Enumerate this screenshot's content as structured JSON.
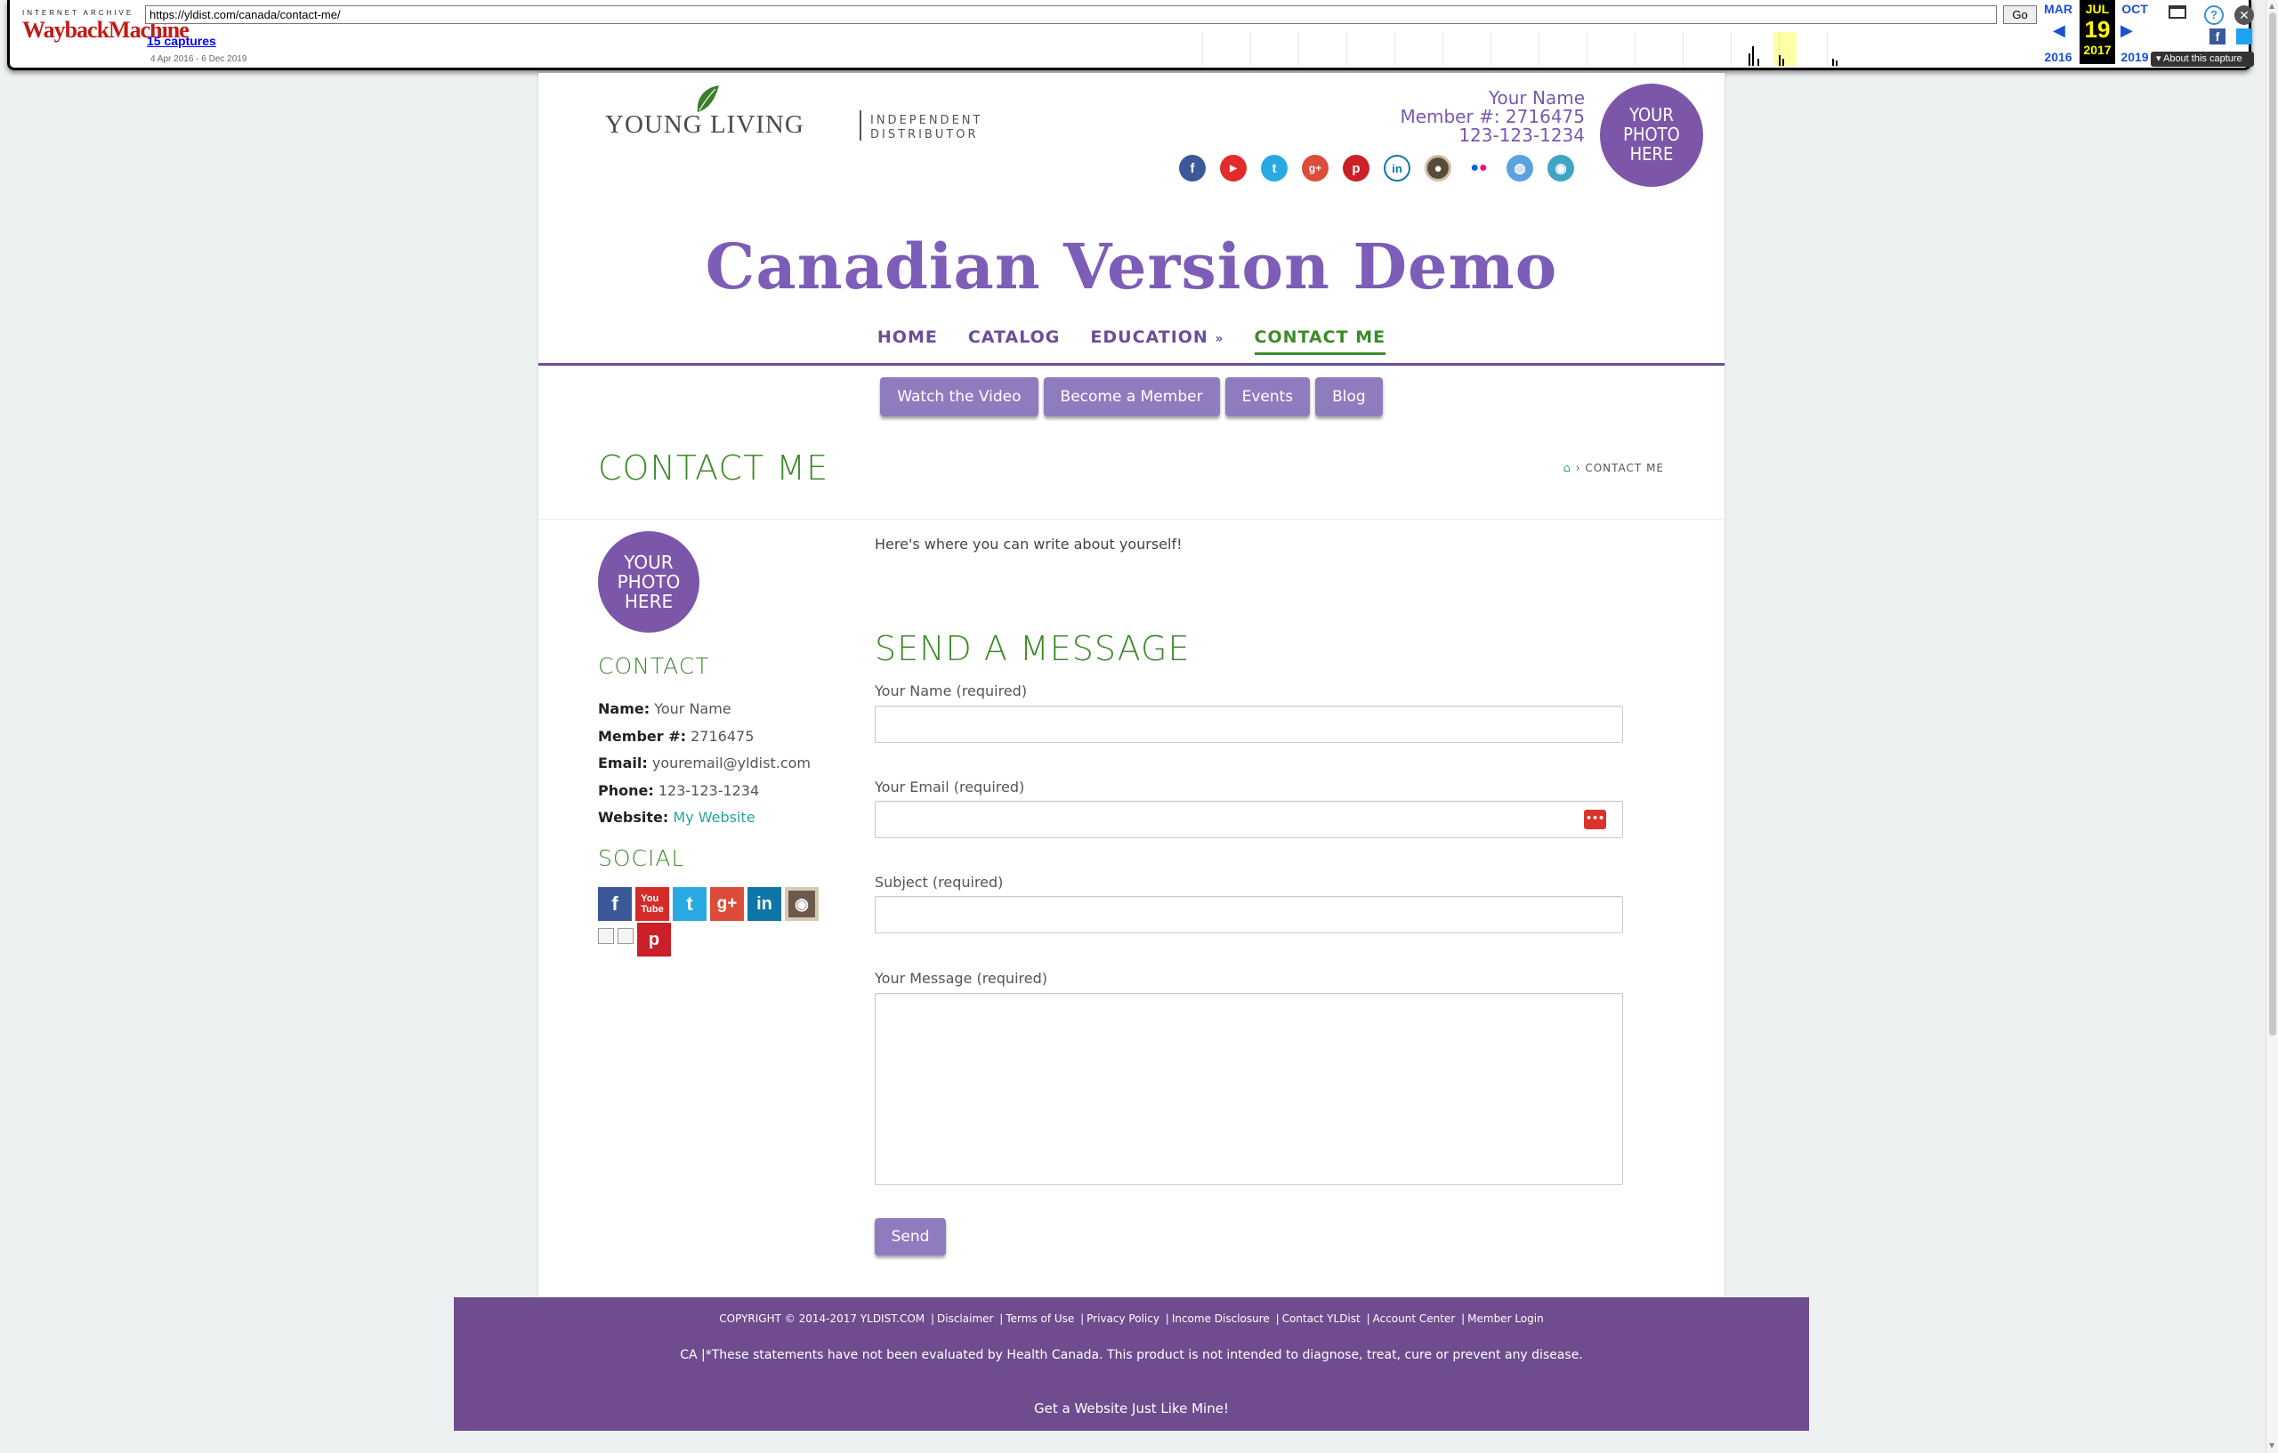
{
  "wayback": {
    "logo_top": "INTERNET ARCHIVE",
    "logo_way": "WaybackMachine",
    "url": "https://yldist.com/canada/contact-me/",
    "go_label": "Go",
    "captures": "15 captures",
    "range": "4 Apr 2016 - 6 Dec 2019",
    "prev_month": "MAR",
    "cur_month": "JUL",
    "next_month": "OCT",
    "cur_day": "19",
    "prev_year": "2016",
    "cur_year": "2017",
    "next_year": "2019",
    "about": "About this capture"
  },
  "header": {
    "logo_brand": "YOUNG LIVING",
    "logo_sub_1": "INDEPENDENT",
    "logo_sub_2": "DISTRIBUTOR",
    "name": "Your Name",
    "member": "Member #: 2716475",
    "phone": "123-123-1234",
    "photo_text_1": "YOUR",
    "photo_text_2": "PHOTO",
    "photo_text_3": "HERE",
    "social_icons": [
      "facebook-icon",
      "youtube-icon",
      "twitter-icon",
      "googleplus-icon",
      "pinterest-icon",
      "linkedin-icon",
      "instagram-icon",
      "flickr-icon",
      "website-icon",
      "periscope-icon"
    ]
  },
  "site_title": "Canadian Version Demo",
  "nav": {
    "items": [
      {
        "label": "HOME"
      },
      {
        "label": "CATALOG"
      },
      {
        "label": "EDUCATION"
      },
      {
        "label": "CONTACT ME"
      }
    ]
  },
  "subnav": {
    "items": [
      {
        "label": "Watch the Video"
      },
      {
        "label": "Become a Member"
      },
      {
        "label": "Events"
      },
      {
        "label": "Blog"
      }
    ]
  },
  "page": {
    "title": "CONTACT ME",
    "breadcrumb_sep": "›",
    "breadcrumb_current": "CONTACT ME"
  },
  "sidebar": {
    "photo_text_1": "YOUR",
    "photo_text_2": "PHOTO",
    "photo_text_3": "HERE",
    "contact_heading": "CONTACT",
    "name_label": "Name:",
    "name_value": "Your Name",
    "member_label": "Member #:",
    "member_value": "2716475",
    "email_label": "Email:",
    "email_value": "youremail@yldist.com",
    "phone_label": "Phone:",
    "phone_value": "123-123-1234",
    "website_label": "Website:",
    "website_value": "My Website",
    "social_heading": "SOCIAL"
  },
  "content": {
    "intro": "Here's where you can write about yourself!",
    "form_heading": "SEND A MESSAGE",
    "name_label": "Your Name (required)",
    "email_label": "Your Email (required)",
    "subject_label": "Subject (required)",
    "message_label": "Your Message (required)",
    "send_label": "Send"
  },
  "footer": {
    "copyright": "COPYRIGHT © 2014-2017  YLDIST.COM",
    "links": [
      "Disclaimer",
      "Terms of Use",
      "Privacy Policy",
      "Income Disclosure",
      "Contact YLDist",
      "Account Center",
      "Member Login"
    ],
    "disclaimer": "CA |*These statements have not been evaluated by Health Canada. This product is not intended to diagnose, treat, cure or prevent any disease.",
    "cta": "Get a Website Just Like Mine!"
  },
  "colors": {
    "purple": "#7c56a8",
    "green": "#3e8a2a",
    "teal": "#26a69a",
    "footer": "#6e4c8e"
  }
}
